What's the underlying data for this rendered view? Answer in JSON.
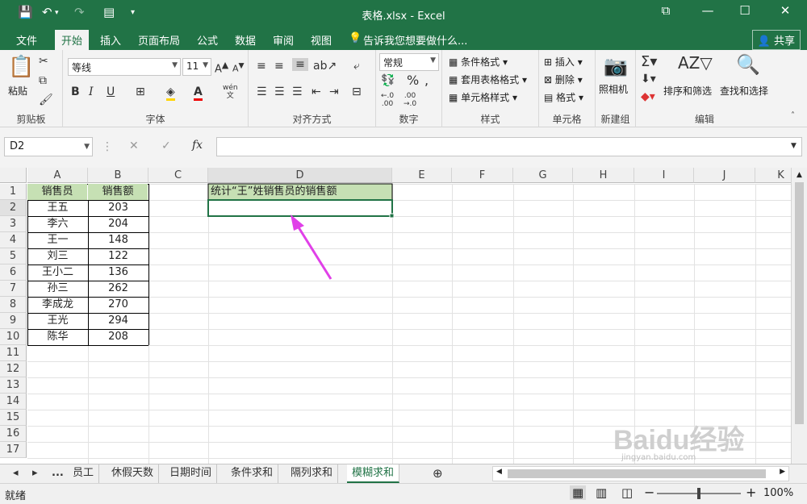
{
  "window": {
    "title": "表格.xlsx - Excel"
  },
  "menu": {
    "tabs": [
      "文件",
      "开始",
      "插入",
      "页面布局",
      "公式",
      "数据",
      "审阅",
      "视图"
    ],
    "active": "开始",
    "tell_me": "告诉我您想要做什么...",
    "share": "共享"
  },
  "ribbon": {
    "clipboard": {
      "label": "剪贴板",
      "paste": "粘贴"
    },
    "font": {
      "label": "字体",
      "name": "等线",
      "size": "11",
      "bold": "B",
      "italic": "I",
      "underline": "U",
      "phonetic": "wén"
    },
    "alignment": {
      "label": "对齐方式"
    },
    "number": {
      "label": "数字",
      "format": "常规"
    },
    "styles": {
      "label": "样式",
      "conditional": "条件格式",
      "table": "套用表格格式",
      "cell": "单元格样式"
    },
    "cells": {
      "label": "单元格",
      "insert": "插入",
      "delete": "删除",
      "format": "格式"
    },
    "newgroup": {
      "label": "新建组",
      "camera": "照相机"
    },
    "editing": {
      "label": "编辑",
      "sort": "排序和筛选",
      "find": "查找和选择"
    }
  },
  "formula_bar": {
    "name_box": "D2",
    "fx": "fx",
    "value": ""
  },
  "sheet": {
    "columns": [
      "A",
      "B",
      "C",
      "D",
      "E",
      "F",
      "G",
      "H",
      "I",
      "J",
      "K"
    ],
    "rows": [
      "1",
      "2",
      "3",
      "4",
      "5",
      "6",
      "7",
      "8",
      "9",
      "10",
      "11",
      "12",
      "13",
      "14",
      "15",
      "16",
      "17"
    ],
    "header": {
      "a": "销售员",
      "b": "销售额"
    },
    "d1": "统计“王”姓销售员的销售额",
    "data": [
      {
        "name": "王五",
        "sales": "203"
      },
      {
        "name": "李六",
        "sales": "204"
      },
      {
        "name": "王一",
        "sales": "148"
      },
      {
        "name": "刘三",
        "sales": "122"
      },
      {
        "name": "王小二",
        "sales": "136"
      },
      {
        "name": "孙三",
        "sales": "262"
      },
      {
        "name": "李成龙",
        "sales": "270"
      },
      {
        "name": "王光",
        "sales": "294"
      },
      {
        "name": "陈华",
        "sales": "208"
      }
    ],
    "selected_cell": "D2",
    "accent": "#217346",
    "header_fill": "#c6e0b4",
    "arrow_color": "#e040e8"
  },
  "sheet_tabs": {
    "more": "...",
    "tabs": [
      "员工",
      "休假天数",
      "日期时间",
      "条件求和",
      "隔列求和",
      "模糊求和"
    ],
    "active": "模糊求和"
  },
  "status_bar": {
    "ready": "就绪",
    "zoom": "100%"
  },
  "watermark": {
    "line1": "Baidu经验",
    "line2": "jingyan.baidu.com"
  }
}
